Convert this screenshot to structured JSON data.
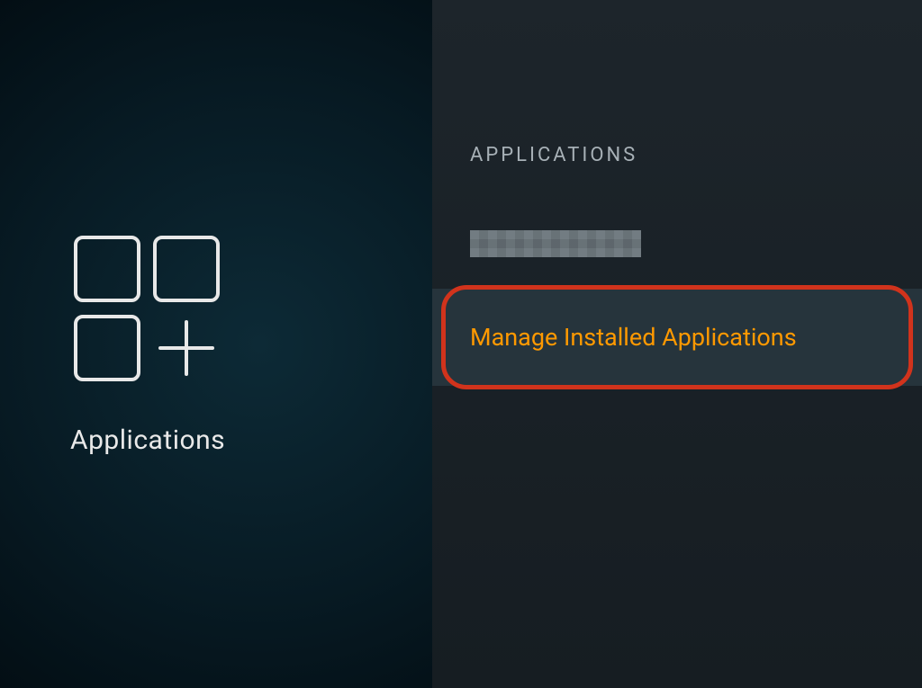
{
  "left": {
    "title": "Applications",
    "icon_name": "apps-grid-icon"
  },
  "right": {
    "section_header": "APPLICATIONS",
    "menu_items": [
      {
        "label": "",
        "obscured": true,
        "focused": false
      },
      {
        "label": "Manage Installed Applications",
        "obscured": false,
        "focused": true,
        "highlighted": true
      }
    ]
  },
  "colors": {
    "accent": "#ff9900",
    "highlight_ring": "#d1331c"
  }
}
